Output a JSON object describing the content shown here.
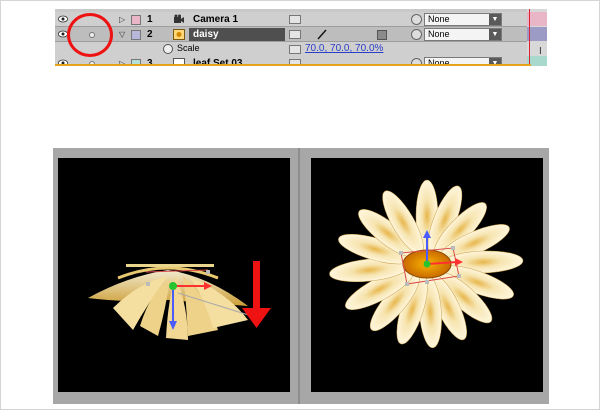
{
  "timeline": {
    "layers": [
      {
        "number": "1",
        "name": "Camera 1",
        "parent": "None",
        "label_color": "#e9b6c8"
      },
      {
        "number": "2",
        "name": "daisy",
        "parent": "None",
        "label_color": "#b7b7da",
        "selected": true
      },
      {
        "number": "3",
        "name": "leaf Set 03",
        "parent": "None",
        "label_color": "#b7e0d8"
      }
    ],
    "property": {
      "name": "Scale",
      "value": "70.0, 70.0, 70.0%"
    },
    "colors": {
      "property_value": "#2a3fc7",
      "selection": "#4f4f4f",
      "annotation": "#ee1212"
    }
  },
  "viewer": {
    "left_view": "flower seen edge-on with red downward arrow",
    "right_view": "flower seen from above with transform gizmo"
  }
}
